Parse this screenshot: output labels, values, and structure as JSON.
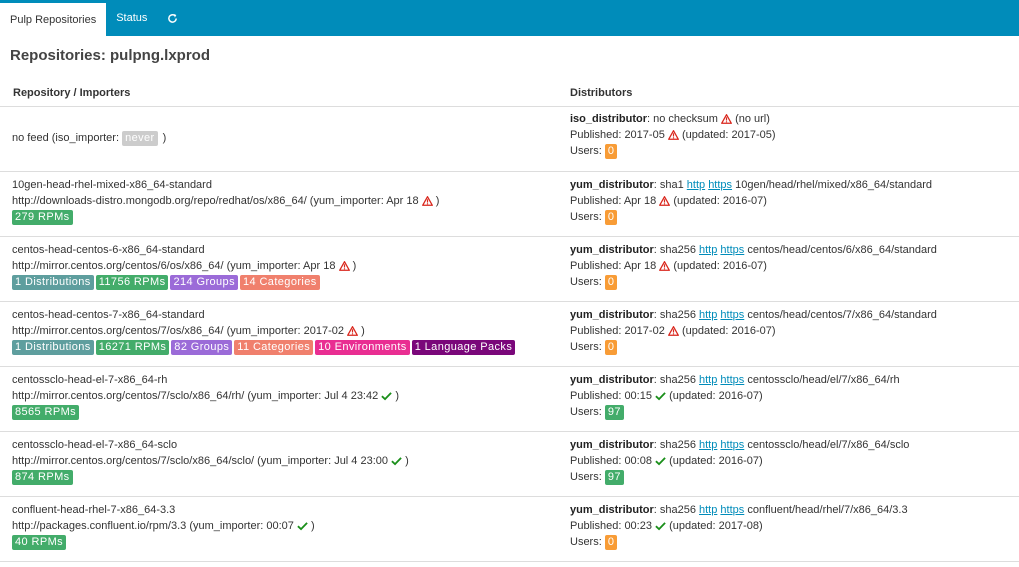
{
  "nav": {
    "tabs": [
      "Pulp Repositories",
      "Status"
    ],
    "refresh_icon": "refresh-icon"
  },
  "page_title": "Repositories: pulpng.lxprod",
  "headers": {
    "repo": "Repository / Importers",
    "dist": "Distributors"
  },
  "labels": {
    "published": "Published:",
    "updated_prefix": "(updated:",
    "updated_suffix": ")",
    "users": "Users:",
    "http": "http",
    "https": "https"
  },
  "colors": {
    "navbar": "#008cba",
    "rpm": "#43ac6a",
    "warn": "#d9261c",
    "ok": "#1a8f1a"
  },
  "rows": [
    {
      "name": "no feed (iso_importer:",
      "never": "never",
      "close": ")",
      "distributor": "iso_distributor",
      "dist_info": ": no checksum",
      "no_url": "(no url)",
      "published": "2017-05",
      "updated": "2017-05",
      "users": "0"
    },
    {
      "name": "10gen-head-rhel-mixed-x86_64-standard",
      "feed": "http://downloads-distro.mongodb.org/repo/redhat/os/x86_64/ (yum_importer: Apr 18",
      "feed_close": ")",
      "badges": [
        "279 RPMs"
      ],
      "distributor": "yum_distributor",
      "checksum": ": sha1",
      "path": "10gen/head/rhel/mixed/x86_64/standard",
      "published": "Apr 18",
      "updated": "2016-07",
      "users": "0"
    },
    {
      "name": "centos-head-centos-6-x86_64-standard",
      "feed": "http://mirror.centos.org/centos/6/os/x86_64/ (yum_importer: Apr 18",
      "feed_close": ")",
      "badges": [
        "1 Distributions",
        "11756 RPMs",
        "214 Groups",
        "14 Categories"
      ],
      "distributor": "yum_distributor",
      "checksum": ": sha256",
      "path": "centos/head/centos/6/x86_64/standard",
      "published": "Apr 18",
      "updated": "2016-07",
      "users": "0"
    },
    {
      "name": "centos-head-centos-7-x86_64-standard",
      "feed": "http://mirror.centos.org/centos/7/os/x86_64/ (yum_importer: 2017-02",
      "feed_close": ")",
      "badges": [
        "1 Distributions",
        "16271 RPMs",
        "82 Groups",
        "11 Categories",
        "10 Environments",
        "1 Language Packs"
      ],
      "distributor": "yum_distributor",
      "checksum": ": sha256",
      "path": "centos/head/centos/7/x86_64/standard",
      "published": "2017-02",
      "updated": "2016-07",
      "users": "0"
    },
    {
      "name": "centosscl​o-head-el-7-x86_64-rh",
      "feed": "http://mirror.centos.org/centos/7/sclo/x86_64/rh/ (yum_importer: Jul 4 23:42",
      "feed_close": ")",
      "badges": [
        "8565 RPMs"
      ],
      "distributor": "yum_distributor",
      "checksum": ": sha256",
      "path": "centossclo/head/el/7/x86_64/rh",
      "published": "00:15",
      "updated": "2016-07",
      "users": "97"
    },
    {
      "name": "centossclo-head-el-7-x86_64-sclo",
      "feed": "http://mirror.centos.org/centos/7/sclo/x86_64/sclo/ (yum_importer: Jul 4 23:00",
      "feed_close": ")",
      "badges": [
        "874 RPMs"
      ],
      "distributor": "yum_distributor",
      "checksum": ": sha256",
      "path": "centossclo/head/el/7/x86_64/sclo",
      "published": "00:08",
      "updated": "2016-07",
      "users": "97"
    },
    {
      "name": "confluent-head-rhel-7-x86_64-3.3",
      "feed": "http://packages.confluent.io/rpm/3.3 (yum_importer: 00:07",
      "feed_close": ")",
      "badges": [
        "40 RPMs"
      ],
      "distributor": "yum_distributor",
      "checksum": ": sha256",
      "path": "confluent/head/rhel/7/x86_64/3.3",
      "published": "00:23",
      "updated": "2017-08",
      "users": "0"
    }
  ]
}
